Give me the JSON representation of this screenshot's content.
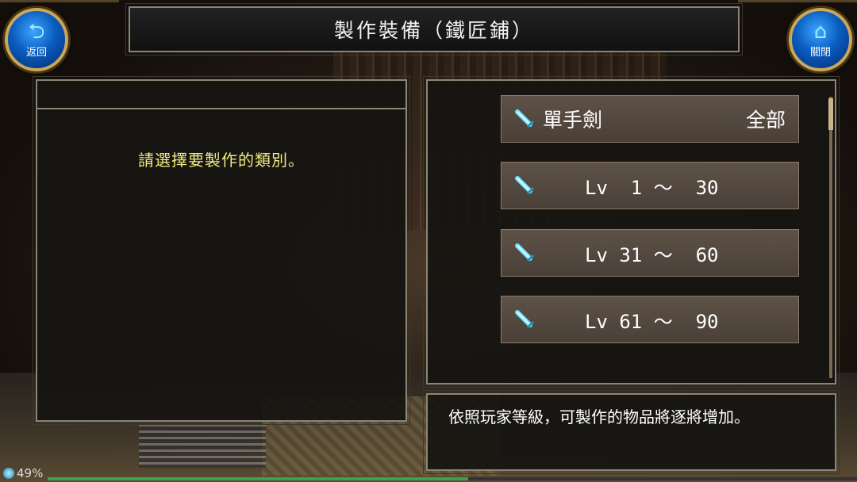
{
  "title": "製作裝備（鐵匠鋪）",
  "back_button": {
    "label": "返回",
    "icon": "back-arrow-icon"
  },
  "close_button": {
    "label": "關閉",
    "icon": "home-icon"
  },
  "left_panel": {
    "prompt": "請選擇要製作的類別。"
  },
  "category": {
    "name": "單手劍",
    "filter": "全部",
    "icon": "sword-icon"
  },
  "level_ranges": [
    {
      "label": "Lv  1 ～  30",
      "icon": "sword-icon"
    },
    {
      "label": "Lv 31 ～  60",
      "icon": "sword-icon"
    },
    {
      "label": "Lv 61 ～  90",
      "icon": "sword-icon"
    }
  ],
  "description": "依照玩家等級，可製作的物品將逐將增加。",
  "status": {
    "battery": "49%",
    "load_progress": 0.52
  },
  "colors": {
    "prompt": "#f4ec82",
    "button_bg": "#554a40",
    "frame": "#8c8574"
  }
}
